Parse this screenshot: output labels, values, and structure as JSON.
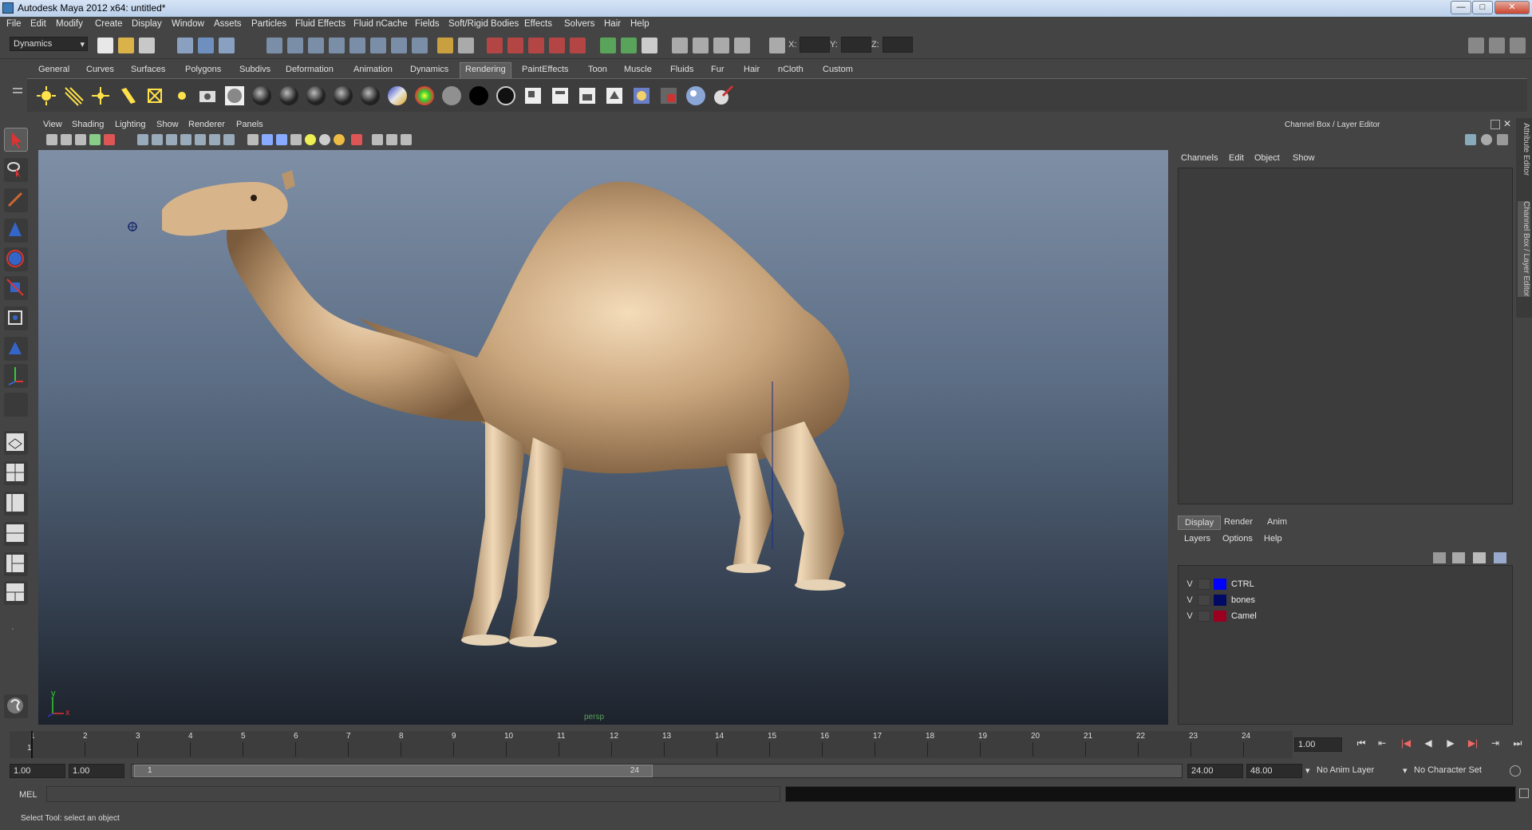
{
  "window": {
    "title": "Autodesk Maya 2012 x64: untitled*",
    "min_label": "—",
    "max_label": "□",
    "close_label": "✕"
  },
  "menubar": [
    "File",
    "Edit",
    "Modify",
    "Create",
    "Display",
    "Window",
    "Assets",
    "Particles",
    "Fluid Effects",
    "Fluid nCache",
    "Fields",
    "Soft/Rigid Bodies",
    "Effects",
    "Solvers",
    "Hair",
    "Help"
  ],
  "statusline": {
    "menuset": "Dynamics",
    "x_label": "X:",
    "y_label": "Y:",
    "z_label": "Z:"
  },
  "shelf": {
    "tabs": [
      "General",
      "Curves",
      "Surfaces",
      "Polygons",
      "Subdivs",
      "Deformation",
      "Animation",
      "Dynamics",
      "Rendering",
      "PaintEffects",
      "Toon",
      "Muscle",
      "Fluids",
      "Fur",
      "Hair",
      "nCloth",
      "Custom"
    ],
    "active_tab": "Rendering"
  },
  "viewport": {
    "menus": [
      "View",
      "Shading",
      "Lighting",
      "Show",
      "Renderer",
      "Panels"
    ],
    "camera_label": "persp",
    "axis_y": "y",
    "axis_x": "x"
  },
  "channelbox": {
    "title": "Channel Box / Layer Editor",
    "menus": [
      "Channels",
      "Edit",
      "Object",
      "Show"
    ]
  },
  "layer_editor": {
    "tabs": [
      "Display",
      "Render",
      "Anim"
    ],
    "active_tab": "Display",
    "menus": [
      "Layers",
      "Options",
      "Help"
    ],
    "layers": [
      {
        "visible": "V",
        "name": "CTRL",
        "color": "#0000ff"
      },
      {
        "visible": "V",
        "name": "bones",
        "color": "#000a64"
      },
      {
        "visible": "V",
        "name": "Camel",
        "color": "#9b0020"
      }
    ]
  },
  "side_tabs": [
    "Attribute Editor",
    "Channel Box / Layer Editor"
  ],
  "timeslider": {
    "ticks": [
      "1",
      "2",
      "3",
      "4",
      "5",
      "6",
      "7",
      "8",
      "9",
      "10",
      "11",
      "12",
      "13",
      "14",
      "15",
      "16",
      "17",
      "18",
      "19",
      "20",
      "21",
      "22",
      "23",
      "24"
    ],
    "current_frame": "1",
    "current_time_field": "1.00"
  },
  "playback": {
    "buttons": [
      "⏮",
      "⇤",
      "|◀",
      "◀",
      "▶",
      "▶|",
      "⇥",
      "⏭"
    ]
  },
  "range": {
    "start_time": "1.00",
    "playback_start": "1.00",
    "range_start_label": "1",
    "range_end_label": "24",
    "playback_end": "24.00",
    "end_time": "48.00",
    "anim_layer": "No Anim Layer",
    "character_set": "No Character Set"
  },
  "command_line": {
    "label": "MEL"
  },
  "help_line": {
    "text": "Select Tool: select an object"
  },
  "colors": {
    "accent": "#5d5d5d",
    "viewport_top": "#7e8fa6",
    "viewport_bottom": "#1d232c",
    "panel_bg": "#444444"
  }
}
